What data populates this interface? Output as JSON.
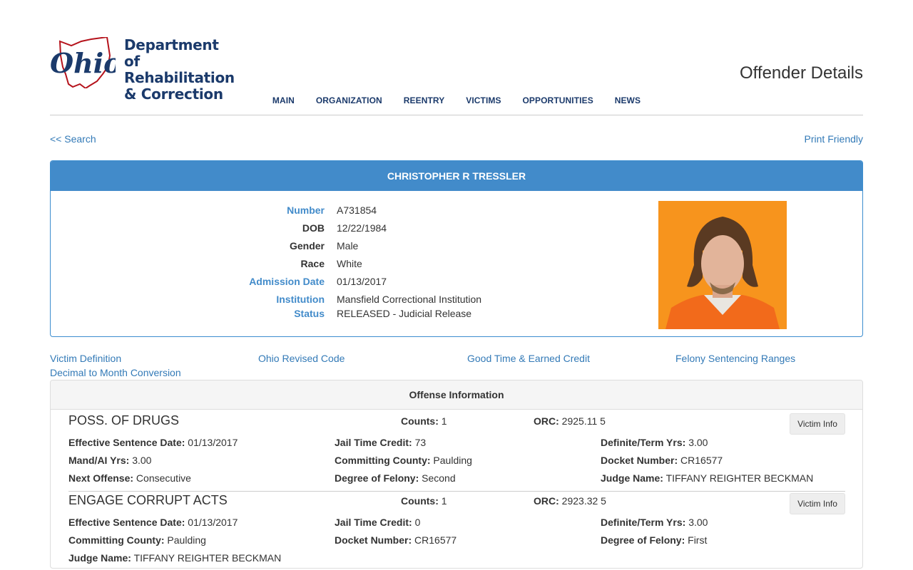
{
  "header": {
    "logo_word": "Ohio",
    "logo_line1": "Department of",
    "logo_line2": "Rehabilitation",
    "logo_line3": "& Correction",
    "page_title": "Offender Details"
  },
  "nav": [
    "MAIN",
    "ORGANIZATION",
    "REENTRY",
    "VICTIMS",
    "OPPORTUNITIES",
    "NEWS"
  ],
  "links": {
    "back": "<< Search",
    "print": "Print Friendly"
  },
  "offender": {
    "name": "CHRISTOPHER R TRESSLER",
    "details": [
      {
        "label": "Number",
        "value": "A731854",
        "label_is_link": true
      },
      {
        "label": "DOB",
        "value": "12/22/1984",
        "label_is_link": false
      },
      {
        "label": "Gender",
        "value": "Male",
        "label_is_link": false
      },
      {
        "label": "Race",
        "value": "White",
        "label_is_link": false
      },
      {
        "label": "Admission Date",
        "value": "01/13/2017",
        "label_is_link": true
      },
      {
        "label": "Institution",
        "value": "Mansfield Correctional Institution",
        "label_is_link": true
      },
      {
        "label": "Status",
        "value": "RELEASED - Judicial Release",
        "label_is_link": true
      }
    ]
  },
  "reference_links": [
    "Victim Definition",
    "Ohio Revised Code",
    "Good Time & Earned Credit",
    "Felony Sentencing Ranges",
    "Decimal to Month Conversion"
  ],
  "offense_section": {
    "heading": "Offense Information",
    "victim_button": "Victim Info",
    "offenses": [
      {
        "title": "POSS. OF DRUGS",
        "counts": {
          "label": "Counts:",
          "value": "1"
        },
        "orc": {
          "label": "ORC:",
          "value": "2925.11 5"
        },
        "fields": [
          {
            "label": "Effective Sentence Date:",
            "value": "01/13/2017"
          },
          {
            "label": "Jail Time Credit:",
            "value": "73"
          },
          {
            "label": "Definite/Term Yrs:",
            "value": "3.00"
          },
          {
            "label": "Mand/AI Yrs:",
            "value": "3.00"
          },
          {
            "label": "Committing County:",
            "value": "Paulding"
          },
          {
            "label": "Docket Number:",
            "value": "CR16577"
          },
          {
            "label": "Next Offense:",
            "value": "Consecutive"
          },
          {
            "label": "Degree of Felony:",
            "value": "Second"
          },
          {
            "label": "Judge Name:",
            "value": "TIFFANY REIGHTER BECKMAN"
          }
        ]
      },
      {
        "title": "ENGAGE CORRUPT ACTS",
        "counts": {
          "label": "Counts:",
          "value": "1"
        },
        "orc": {
          "label": "ORC:",
          "value": "2923.32 5"
        },
        "fields": [
          {
            "label": "Effective Sentence Date:",
            "value": "01/13/2017"
          },
          {
            "label": "Jail Time Credit:",
            "value": "0"
          },
          {
            "label": "Definite/Term Yrs:",
            "value": "3.00"
          },
          {
            "label": "Committing County:",
            "value": "Paulding"
          },
          {
            "label": "Docket Number:",
            "value": "CR16577"
          },
          {
            "label": "Degree of Felony:",
            "value": "First"
          },
          {
            "label": "Judge Name:",
            "value": "TIFFANY REIGHTER BECKMAN"
          }
        ]
      }
    ]
  },
  "colors": {
    "brand_navy": "#1b3a6b",
    "brand_red": "#b5121b",
    "link_blue": "#337ab7",
    "panel_header_blue": "#428bca"
  }
}
